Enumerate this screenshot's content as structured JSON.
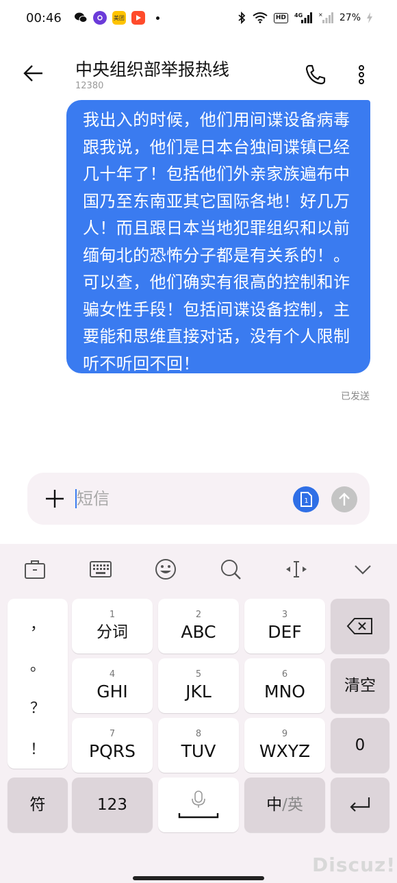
{
  "status_bar": {
    "time": "00:46",
    "battery": "27%",
    "hd_label": "HD",
    "network": "4G",
    "meituan_label": "美团"
  },
  "header": {
    "title": "中央组织部举报热线",
    "number": "12380"
  },
  "message": {
    "text": "我出入的时候，他们用间谍设备病毒跟我说，他们是日本台独间谍镇已经几十年了！包括他们外亲家族遍布中国乃至东南亚其它国际各地！好几万人！而且跟日本当地犯罪组织和以前缅甸北的恐怖分子都是有关系的！。可以查，他们确实有很高的控制和诈骗女性手段！包括间谍设备控制，主要能和思维直接对话，没有个人限制听不听回不回！",
    "status": "已发送"
  },
  "compose": {
    "placeholder": "短信",
    "sim_label": "1"
  },
  "keyboard": {
    "punctuation": [
      "，",
      "。",
      "？",
      "！"
    ],
    "keys": [
      {
        "num": "1",
        "label": "分词"
      },
      {
        "num": "2",
        "label": "ABC"
      },
      {
        "num": "3",
        "label": "DEF"
      },
      {
        "num": "4",
        "label": "GHI"
      },
      {
        "num": "5",
        "label": "JKL"
      },
      {
        "num": "6",
        "label": "MNO"
      },
      {
        "num": "7",
        "label": "PQRS"
      },
      {
        "num": "8",
        "label": "TUV"
      },
      {
        "num": "9",
        "label": "WXYZ"
      }
    ],
    "clear_label": "清空",
    "zero_label": "0",
    "symbol_label": "符",
    "numeric_label": "123",
    "lang_primary": "中",
    "lang_separator": "/",
    "lang_secondary": "英"
  },
  "watermark": "Discuz!",
  "colors": {
    "bubble": "#3a7bf0",
    "sim_button": "#2f6fe6",
    "send_button_disabled": "#c4c4c4",
    "keyboard_bg": "#f6f0f4"
  }
}
